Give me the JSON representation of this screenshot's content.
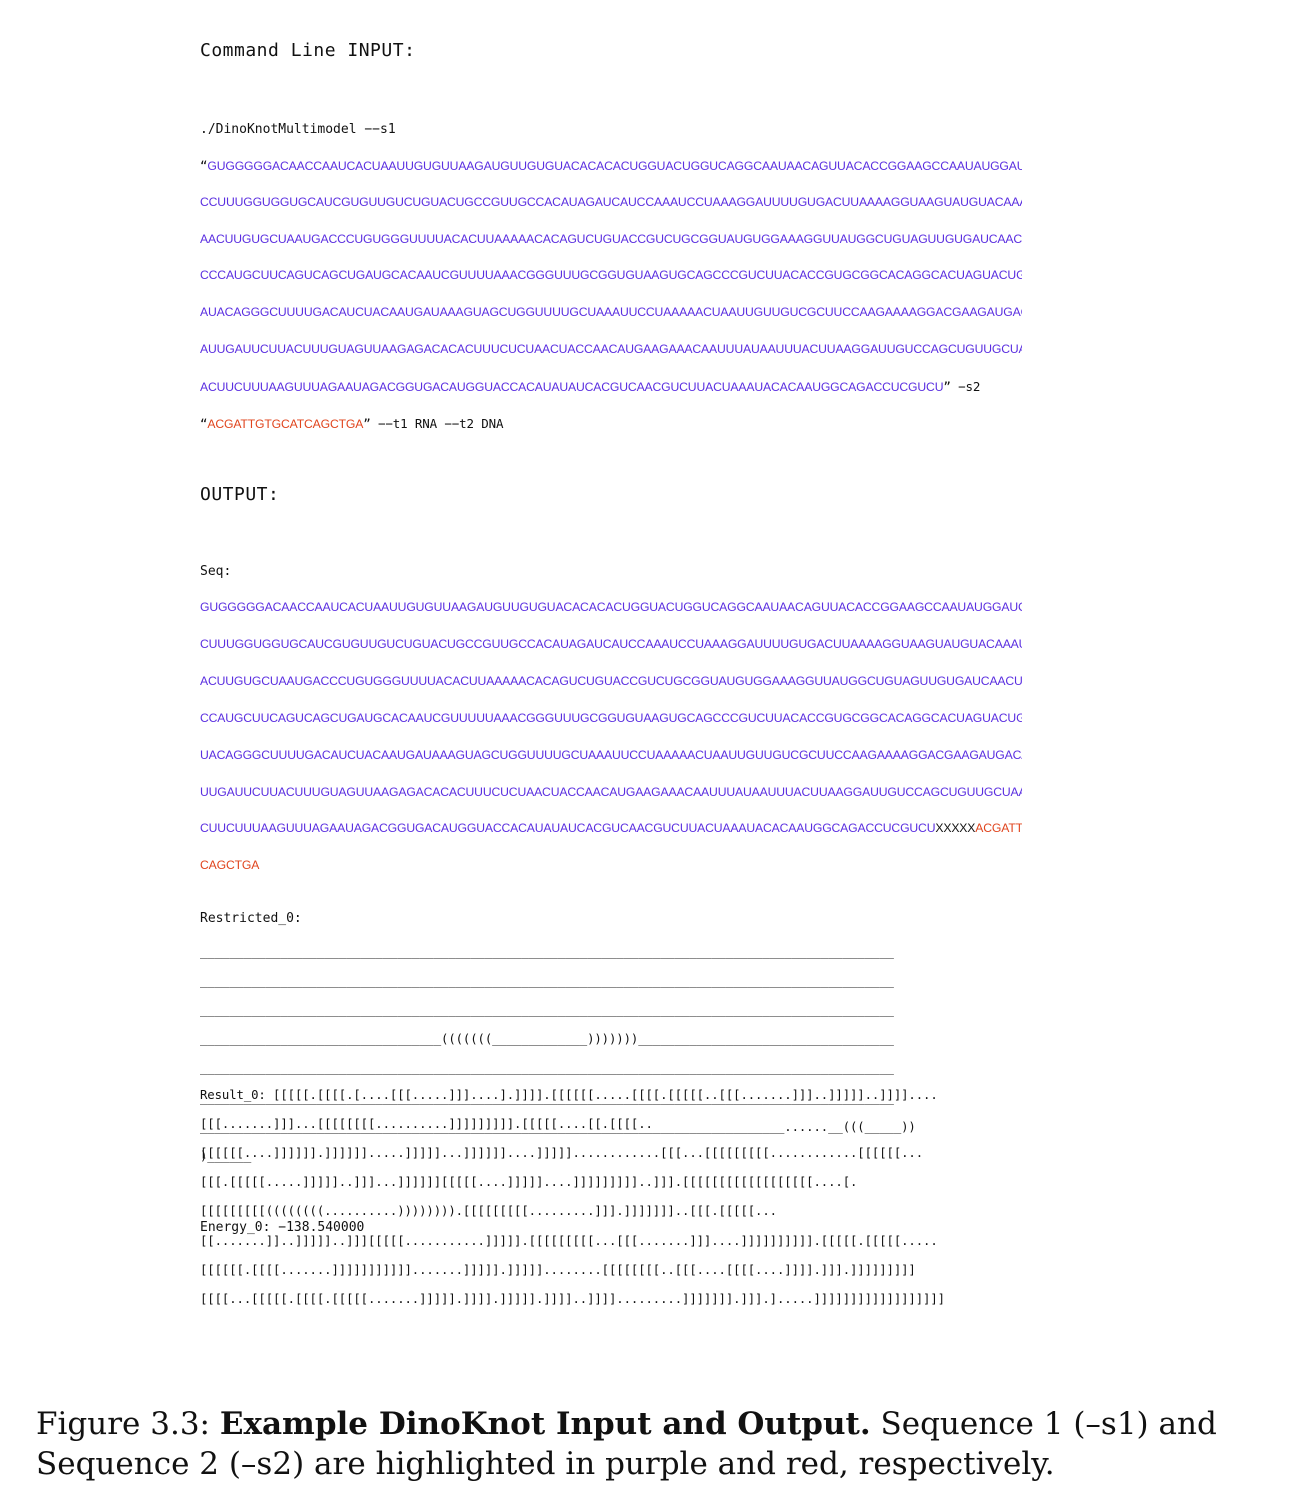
{
  "input": {
    "heading": "Command Line INPUT:",
    "cmd_prefix": "./DinoKnotMultimodel −−s1",
    "open_quote": "“",
    "s1_lines": [
      "GUGGGGGACAACCAAUCACUAAUUGUGUUAAGAUGUUGUGUACACACACUGGUACUGGUCAGGCAAUAACAGUUACACCGGAAGCCAAUAUGGAUCAAGAAU",
      "CCUUUGGUGGUGCAUCGUGUUGUCUGUACUGCCGUUGCCACAUAGAUCAUCCAAAUCCUAAAGGAUUUUGUGACUUAAAAGGUAAGUAUGUACAAAUACCUAC",
      "AACUUGUGCUAAUGACCCUGUGGGUUUUACACUUAAAAACACAGUCUGUACCGUCUGCGGUAUGUGGAAAGGUUAUGGCUGUAGUUGUGAUCAACUCCGCGAA",
      "CCCAUGCUUCAGUCAGCUGAUGCACAAUCGUUUUAAACGGGUUUGCGGUGUAAGUGCAGCCCGUCUUACACCGUGCGGCACAGGCACUAGUACUGAUGUCGU",
      "AUACAGGGCUUUUGACAUCUACAAUGAUAAAGUAGCUGGUUUUGCUAAAUUCCUAAAAACUAAUUGUUGUCGCUUCCAAGAAAAGGACGAAGAUGACAAUUUA",
      "AUUGAUUCUUACUUUGUAGUUAAGAGACACACUUUCUCUAACUACCAACAUGAAGAAACAAUUUAUAAUUUACUUAAGGAUUGUCCAGCUGUUGCUAAACAUG",
      "ACUUCUUUAAGUUUAGAAUAGACGGUGACAUGGUACCACAUAUAUCACGUCAACGUCUUACUAAAUACACAAUGGCAGACCUCGUCU"
    ],
    "s1_close": "” −s2",
    "s2_open": "“",
    "s2_seq": "ACGATTGTGCATCAGCTGA",
    "s2_tail": "” −−t1 RNA −−t2 DNA"
  },
  "output": {
    "heading": "OUTPUT:",
    "seq_label": "Seq:",
    "seq_lines": [
      "GUGGGGGACAACCAAUCACUAAUUGUGUUAAGAUGUUGUGUACACACACUGGUACUGGUCAGGCAAUAACAGUUACACCGGAAGCCAAUAUGGAUCAAGAAUC",
      "CUUUGGUGGUGCAUCGUGUUGUCUGUACUGCCGUUGCCACAUAGAUCAUCCAAAUCCUAAAGGAUUUUGUGACUUAAAAGGUAAGUAUGUACAAAUACCUACA",
      "ACUUGUGCUAAUGACCCUGUGGGUUUUACACUUAAAAACACAGUCUGUACCGUCUGCGGUAUGUGGAAAGGUUAUGGCUGUAGUUGUGAUCAACUCCGCGAAC",
      "CCAUGCUUCAGUCAGCUGAUGCACAAUCGUUUUUAAACGGGUUUGCGGUGUAAGUGCAGCCCGUCUUACACCGUGCGGCACAGGCACUAGUACUGAUGUCGUA",
      "UACAGGGCUUUUGACAUCUACAAUGAUAAAGUAGCUGGUUUUGCUAAAUUCCUAAAAACUAAUUGUUGUCGCUUCCAAGAAAAGGACGAAGAUGACAAUUUAA",
      "UUGAUUCUUACUUUGUAGUUAAGAGACACACUUUCUCUAACUACCAACAUGAAGAAACAAUUUAUAAUUUACUUAAGGAUUGUCCAGCUGUUGCUAAACAUGA"
    ],
    "seq_last_s1": "CUUCUUUAAGUUUAGAAUAGACGGUGACAUGGUACCACAUAUAUCACGUCAACGUCUUACUAAAUACACAAUGGCAGACCUCGUCU",
    "seq_linker": "XXXXX",
    "seq_last_s2": "ACGATTGTGCAT",
    "seq_overflow_s2": "CAGCTGA",
    "restricted_label": "Restricted_0:",
    "restricted_lines": [
      "_______________________________________________________________________________________________",
      "_______________________________________________________________________________________________",
      "_______________________________________________________________________________________________",
      "_________________________________(((((((_____________)))))))___________________________________",
      "_______________________________________________________________________________________________",
      "_______________________________________________________________________________________________",
      "________________________________________________________________________________......__(((_____))",
      ")______"
    ],
    "result_lines": [
      "Result_0: [[[[[.[[[[.[....[[[.....]]]....].]]]].[[[[[[.....[[[[.[[[[[..[[[.......]]]..]]]]]..]]]]....",
      "[[[.......]]]...[[[[[[[[..........]]]]]]]]].[[[[[....[[.[[[[..",
      "[[[[[[....]]]]]].]]]]]].....]]]]]...]]]]]]....]]]]]............[[[...[[[[[[[[[............[[[[[[...",
      "[[[.[[[[[.....]]]]]..]]]...]]]]]][[[[[....]]]]]....]]]]]]]]]..]]].[[[[[[[[[[[[[[[[[[....[.",
      "[[[[[[[[[((((((((..........)))))))).[[[[[[[[[.........]]].]]]]]]]..[[[.[[[[[...",
      "[[.......]]..]]]]]..]]][[[[[...........]]]]].[[[[[[[[[...[[[.......]]]....]]]]]]]]]].[[[[[.[[[[[.....",
      "[[[[[[.[[[[.......]]]]]]]]]]].......]]]]].]]]]]........[[[[[[[[..[[[....[[[[....]]]].]]].]]]]]]]]]",
      "[[[[...[[[[[.[[[[.[[[[[.......]]]]].]]]].]]]]].]]]]..]]]].........]]]]]]].]]].].....]]]]]]]]]]]]]]]]]]"
    ],
    "energy": "Energy_0: −138.540000"
  },
  "caption": {
    "label": "Figure 3.3:",
    "title": "Example DinoKnot Input and Output.",
    "text": "Sequence 1 (–s1) and Sequence 2 (–s2) are highlighted in purple and red, respectively."
  },
  "colors": {
    "s1": "#5a2ee0",
    "s2": "#e0441d"
  }
}
